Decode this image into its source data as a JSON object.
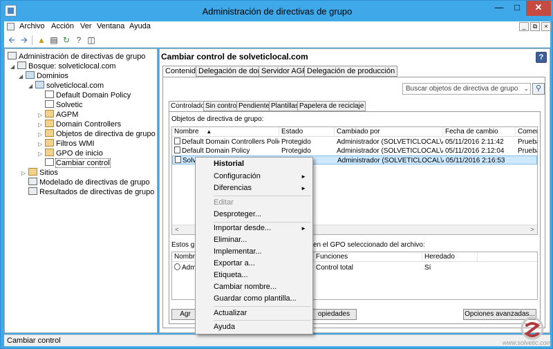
{
  "window": {
    "title": "Administración de directivas de grupo"
  },
  "menubar": {
    "items": [
      "Archivo",
      "Acción",
      "Ver",
      "Ventana",
      "Ayuda"
    ]
  },
  "tree": {
    "items": [
      {
        "label": "Administración de directivas de grupo"
      },
      {
        "label": "Bosque: solveticlocal.com"
      },
      {
        "label": "Dominios"
      },
      {
        "label": "solveticlocal.com"
      },
      {
        "label": "Default Domain Policy"
      },
      {
        "label": "Solvetic"
      },
      {
        "label": "AGPM"
      },
      {
        "label": "Domain Controllers"
      },
      {
        "label": "Objetos de directiva de grupo"
      },
      {
        "label": "Filtros WMI"
      },
      {
        "label": "GPO de inicio"
      },
      {
        "label": "Cambiar control"
      },
      {
        "label": "Sitios"
      },
      {
        "label": "Modelado de directivas de grupo"
      },
      {
        "label": "Resultados de directivas de grupo"
      }
    ]
  },
  "right": {
    "title": "Cambiar control de solveticlocal.com",
    "tabs": [
      "Contenido",
      "Delegación de dominio",
      "Servidor AGPM",
      "Delegación de producción"
    ],
    "search_placeholder": "Buscar objetos de directiva de grupo",
    "subtabs": [
      "Controlado",
      "Sin control",
      "Pendiente",
      "Plantillas",
      "Papelera de reciclaje"
    ],
    "objects_label": "Objetos de directiva de grupo:",
    "columns": [
      "Nombre",
      "Estado",
      "Cambiado por",
      "Fecha de cambio",
      "Comen"
    ],
    "rows": [
      {
        "name": "Default Domain Controllers Policy",
        "state": "Protegido",
        "by": "Administrador (SOLVETICLOCAL\\Ad...",
        "date": "05/11/2016 2:11:42",
        "comment": "Prueba"
      },
      {
        "name": "Default Domain Policy",
        "state": "Protegido",
        "by": "Administrador (SOLVETICLOCAL\\Ad...",
        "date": "05/11/2016 2:12:04",
        "comment": "Prueba"
      },
      {
        "name": "Solvetic GPO",
        "state": "Protegido",
        "by": "Administrador (SOLVETICLOCAL\\Ad...",
        "date": "05/11/2016 2:16:53",
        "comment": ""
      }
    ],
    "lower_label_left": "Estos gru",
    "lower_label_right": "en el GPO seleccionado del archivo:",
    "lower_columns": [
      "Nombre",
      "Funciones",
      "Heredado"
    ],
    "lower_rows": [
      {
        "name": "Admi",
        "roles": "Control total",
        "inherited": "Sí"
      }
    ],
    "btn_add": "Agr",
    "btn_props": "opiedades",
    "btn_advanced": "Opciones avanzadas..."
  },
  "context_menu": {
    "items": [
      {
        "label": "Historial",
        "bold": true
      },
      {
        "label": "Configuración",
        "submenu": true
      },
      {
        "label": "Diferencias",
        "submenu": true
      },
      {
        "label": "Editar",
        "disabled": true
      },
      {
        "label": "Desproteger..."
      },
      {
        "label": "Importar desde...",
        "submenu": true
      },
      {
        "label": "Eliminar..."
      },
      {
        "label": "Implementar..."
      },
      {
        "label": "Exportar a..."
      },
      {
        "label": "Etiqueta..."
      },
      {
        "label": "Cambiar nombre..."
      },
      {
        "label": "Guardar como plantilla..."
      },
      {
        "label": "Actualizar"
      },
      {
        "label": "Ayuda"
      }
    ],
    "submenu_arrow": "►"
  },
  "status": {
    "text": "Cambiar control"
  },
  "watermark": {
    "text": "www.solvetic.com"
  }
}
